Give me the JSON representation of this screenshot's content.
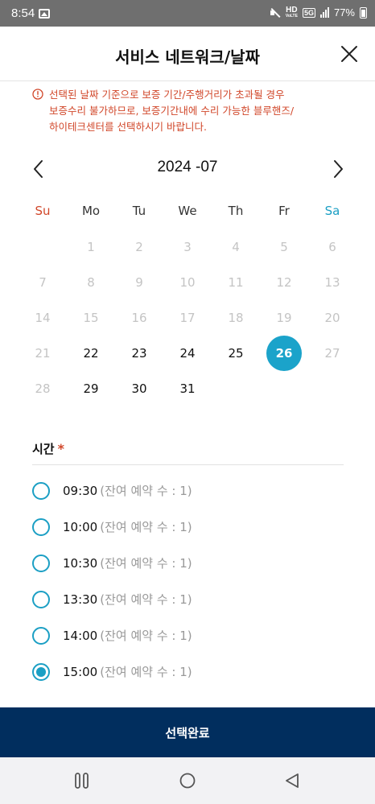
{
  "status_bar": {
    "time": "8:54",
    "hd_label": "HD",
    "hd_sub": "VoLTE",
    "network": "5G",
    "battery": "77%"
  },
  "header": {
    "title": "서비스 네트워크/날짜"
  },
  "notice": {
    "lines": [
      "선택된 날짜 기준으로 보증 기간/주행거리가 초과될 경우",
      "보증수리 불가하므로, 보증기간내에 수리 가능한 블루핸즈/",
      "하이테크센터를 선택하시기 바랍니다."
    ]
  },
  "calendar": {
    "month_label": "2024 -07",
    "weekdays": [
      "Su",
      "Mo",
      "Tu",
      "We",
      "Th",
      "Fr",
      "Sa"
    ],
    "weeks": [
      [
        "",
        "1",
        "2",
        "3",
        "4",
        "5",
        "6"
      ],
      [
        "7",
        "8",
        "9",
        "10",
        "11",
        "12",
        "13"
      ],
      [
        "14",
        "15",
        "16",
        "17",
        "18",
        "19",
        "20"
      ],
      [
        "21",
        "22",
        "23",
        "24",
        "25",
        "26",
        "27"
      ],
      [
        "28",
        "29",
        "30",
        "31",
        "",
        "",
        ""
      ]
    ],
    "active_days": [
      "22",
      "23",
      "24",
      "25",
      "26",
      "29",
      "30",
      "31"
    ],
    "selected_day": "26",
    "accent_color": "#1ba3ca"
  },
  "time_section": {
    "label": "시간",
    "required_mark": "*",
    "slots": [
      {
        "time": "09:30",
        "remain": "(잔여 예약 수 : 1)",
        "checked": false
      },
      {
        "time": "10:00",
        "remain": "(잔여 예약 수 : 1)",
        "checked": false
      },
      {
        "time": "10:30",
        "remain": "(잔여 예약 수 : 1)",
        "checked": false
      },
      {
        "time": "13:30",
        "remain": "(잔여 예약 수 : 1)",
        "checked": false
      },
      {
        "time": "14:00",
        "remain": "(잔여 예약 수 : 1)",
        "checked": false
      },
      {
        "time": "15:00",
        "remain": "(잔여 예약 수 : 1)",
        "checked": true
      }
    ]
  },
  "confirm": {
    "label": "선택완료",
    "color": "#012e5e"
  }
}
